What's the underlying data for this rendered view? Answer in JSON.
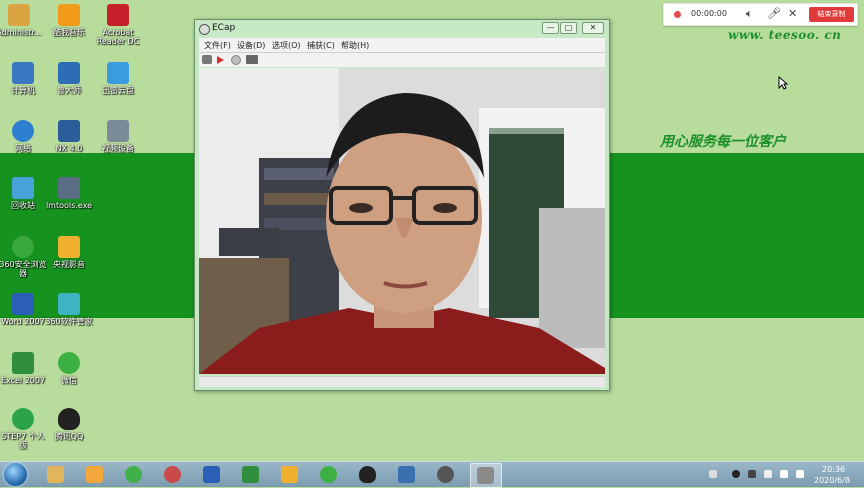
{
  "desktop": {
    "icons": [
      {
        "label": "Administr...",
        "color": "#d9a441"
      },
      {
        "label": "酷我音乐",
        "color": "#f29a1a"
      },
      {
        "label": "Acrobat Reader DC",
        "color": "#c8202a"
      },
      {
        "label": "计算机",
        "color": "#3a78c2"
      },
      {
        "label": "鲁大师",
        "color": "#2e6db5"
      },
      {
        "label": "迅雷云盘",
        "color": "#3a9be0"
      },
      {
        "label": "网络",
        "color": "#2f7fd0"
      },
      {
        "label": "NX 4.0",
        "color": "#2a5d9a"
      },
      {
        "label": "视频设备",
        "color": "#7a8a99"
      },
      {
        "label": "回收站",
        "color": "#4aa3d8"
      },
      {
        "label": "lmtools.exe",
        "color": "#5a6f85"
      },
      {
        "label": "360安全浏览器",
        "color": "#38a83f"
      },
      {
        "label": "央视影音",
        "color": "#f0b030"
      },
      {
        "label": "Word 2007",
        "color": "#2b5fb5"
      },
      {
        "label": "360软件管家",
        "color": "#3cb4c4"
      },
      {
        "label": "Excel 2007",
        "color": "#2f8f3f"
      },
      {
        "label": "微信",
        "color": "#3cb043"
      },
      {
        "label": "STEP7 个人版",
        "color": "#2aa34a"
      },
      {
        "label": "腾讯QQ",
        "color": "#222222"
      }
    ]
  },
  "brand": {
    "url": "www. teesoo. cn",
    "slogan": "用心服务每一位客户",
    "accent": "#16931f"
  },
  "window": {
    "title": "ECap",
    "minimize": "—",
    "maximize": "□",
    "close": "✕",
    "menu": [
      "文件(F)",
      "设备(D)",
      "选项(O)",
      "捕获(C)",
      "帮助(H)"
    ],
    "toolbar_icons": [
      "camera-icon",
      "record-icon",
      "stop-icon",
      "settings-icon"
    ]
  },
  "recorder": {
    "time": "00:00:00",
    "button": "结束录制"
  },
  "taskbar": {
    "apps": [
      "explorer-icon",
      "software-icon",
      "browser-360-icon",
      "tools-icon",
      "word-icon",
      "excel-icon",
      "cctv-icon",
      "wechat-icon",
      "qq-icon",
      "ecap-network-icon",
      "microphone-icon",
      "ecap-icon"
    ],
    "clock_time": "20:36",
    "clock_date": "2020/6/8"
  }
}
